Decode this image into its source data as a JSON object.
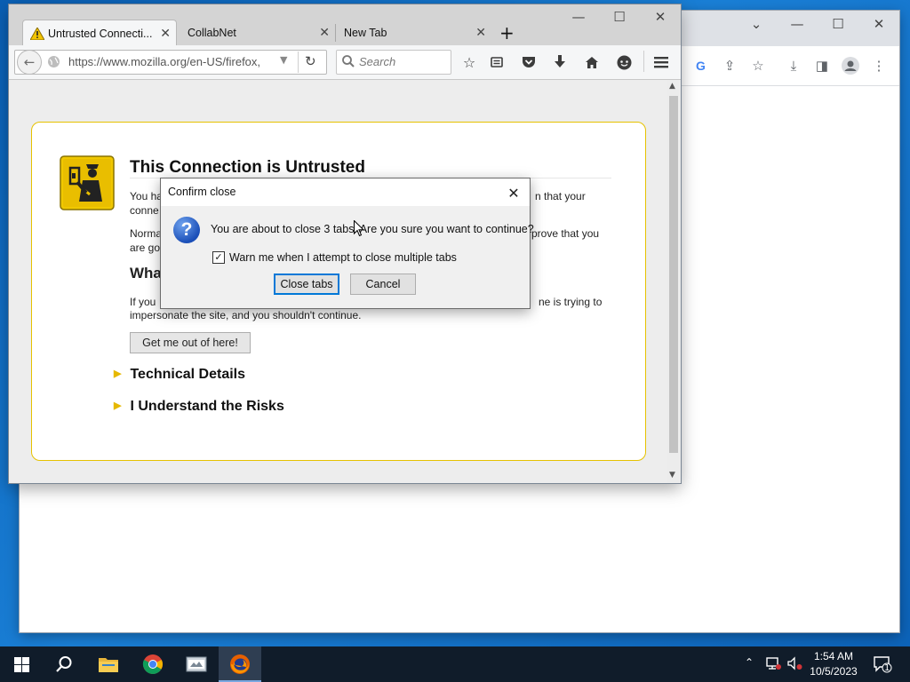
{
  "chrome_window": {
    "window_controls": [
      "chevron-down-icon",
      "minimize-icon",
      "maximize-icon",
      "close-icon"
    ],
    "toolbar_icons": [
      "google-icon",
      "share-icon",
      "star-icon",
      "download-icon",
      "sidebar-icon",
      "profile-icon",
      "menu-icon"
    ]
  },
  "firefox": {
    "tabs": [
      {
        "label": "Untrusted Connecti...",
        "icon": "warning-icon",
        "active": true
      },
      {
        "label": "CollabNet",
        "active": false
      },
      {
        "label": "New Tab",
        "active": false
      }
    ],
    "new_tab_symbol": "+",
    "url": "https://www.mozilla.org/en-US/firefox,",
    "search_placeholder": "Search",
    "toolbar_icons": [
      "back-icon",
      "reload-icon",
      "bookmark-star-icon",
      "reading-list-icon",
      "pocket-icon",
      "download-icon",
      "home-icon",
      "chat-icon",
      "menu-icon"
    ]
  },
  "error_page": {
    "title": "This Connection is Untrusted",
    "p1_left": "You ha",
    "p1_left2": "conne",
    "p1_right": "n that your",
    "p2_left": "Norma",
    "p2_left2": "are go",
    "p2_right": "prove that you",
    "heading2": "Wha",
    "p3_left": "If you",
    "p3_right": "ne is trying to",
    "p3_line2": "impersonate the site, and you shouldn't continue.",
    "get_out_button": "Get me out of here!",
    "technical_details": "Technical Details",
    "understand_risks": "I Understand the Risks"
  },
  "dialog": {
    "title": "Confirm close",
    "message": "You are about to close 3 tabs. Are you sure you want to continue?",
    "checkbox_label": "Warn me when I attempt to close multiple tabs",
    "checkbox_checked": true,
    "check_mark": "✓",
    "close_tabs_button": "Close tabs",
    "cancel_button": "Cancel"
  },
  "taskbar": {
    "apps": [
      "windows-start-icon",
      "search-icon",
      "file-explorer-icon",
      "chrome-icon",
      "app-icon",
      "firefox-icon"
    ],
    "time": "1:54 AM",
    "date": "10/5/2023",
    "notification_count": "1"
  },
  "colors": {
    "accent": "#0078d7",
    "error_border": "#e6c200",
    "desktop": "#0a5fb4"
  }
}
